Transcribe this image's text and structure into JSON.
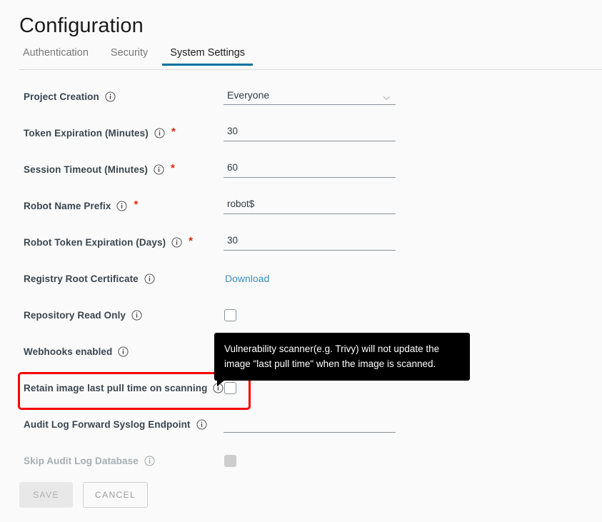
{
  "header": {
    "title": "Configuration",
    "tabs": [
      {
        "label": "Authentication",
        "active": false
      },
      {
        "label": "Security",
        "active": false
      },
      {
        "label": "System Settings",
        "active": true
      }
    ]
  },
  "form": {
    "rows": [
      {
        "label": "Project Creation",
        "icon": "info-icon",
        "required": false,
        "control": "select",
        "value": "Everyone",
        "name": "project-creation"
      },
      {
        "label": "Token Expiration (Minutes)",
        "icon": "info-icon",
        "required": true,
        "control": "text",
        "value": "30",
        "name": "token-expiration"
      },
      {
        "label": "Session Timeout (Minutes)",
        "icon": "info-icon",
        "required": true,
        "control": "text",
        "value": "60",
        "name": "session-timeout"
      },
      {
        "label": "Robot Name Prefix",
        "icon": "info-icon",
        "required": true,
        "control": "text",
        "value": "robot$",
        "name": "robot-name-prefix"
      },
      {
        "label": "Robot Token Expiration (Days)",
        "icon": "info-icon",
        "required": true,
        "control": "text",
        "value": "30",
        "name": "robot-token-expiration"
      },
      {
        "label": "Registry Root Certificate",
        "icon": "info-icon",
        "required": false,
        "control": "link",
        "value": "Download",
        "name": "registry-root-certificate"
      },
      {
        "label": "Repository Read Only",
        "icon": "info-icon",
        "required": false,
        "control": "checkbox",
        "checked": false,
        "name": "repository-read-only"
      },
      {
        "label": "Webhooks enabled",
        "icon": "info-icon",
        "required": false,
        "control": "checkbox",
        "checked": false,
        "name": "webhooks-enabled"
      },
      {
        "label": "Retain image last pull time on scanning",
        "icon": "info-icon",
        "required": false,
        "control": "checkbox",
        "checked": false,
        "name": "retain-image-last-pull-time"
      },
      {
        "label": "Audit Log Forward Syslog Endpoint",
        "icon": "info-icon",
        "required": false,
        "control": "text",
        "value": "",
        "name": "audit-log-forward-syslog-endpoint"
      },
      {
        "label": "Skip Audit Log Database",
        "icon": "info-icon",
        "required": false,
        "control": "checkbox",
        "checked": false,
        "disabled": true,
        "name": "skip-audit-log-database"
      }
    ]
  },
  "tooltip": {
    "text": "Vulnerability scanner(e.g. Trivy) will not update the image \"last pull time\" when the image is scanned."
  },
  "annotation": {
    "color": "#fb0000",
    "target": "retain-image-last-pull-time"
  },
  "footer": {
    "save_label": "SAVE",
    "cancel_label": "CANCEL"
  },
  "colors": {
    "accent": "#0072a3",
    "link": "#3790bc",
    "required": "#e02200",
    "tooltip_bg": "#000000",
    "highlight": "#fb0000"
  }
}
